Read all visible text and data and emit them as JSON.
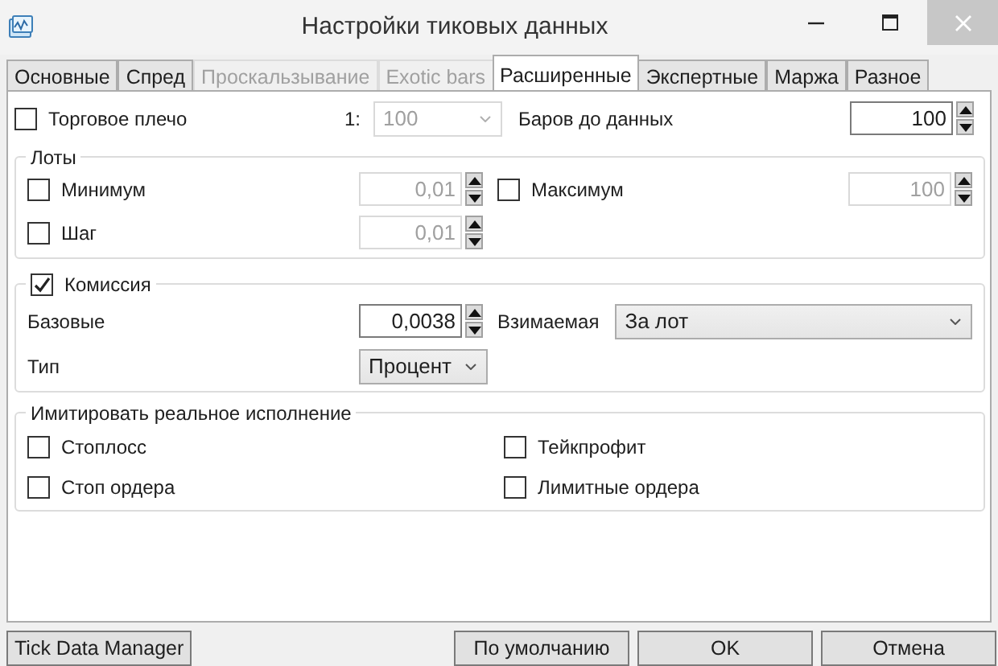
{
  "window": {
    "title": "Настройки тиковых данных"
  },
  "tabs": [
    {
      "label": "Основные",
      "selected": false,
      "disabled": false
    },
    {
      "label": "Спред",
      "selected": false,
      "disabled": false
    },
    {
      "label": "Проскальзывание",
      "selected": false,
      "disabled": true
    },
    {
      "label": "Exotic bars",
      "selected": false,
      "disabled": true
    },
    {
      "label": "Расширенные",
      "selected": true,
      "disabled": false
    },
    {
      "label": "Экспертные",
      "selected": false,
      "disabled": false
    },
    {
      "label": "Маржа",
      "selected": false,
      "disabled": false
    },
    {
      "label": "Разное",
      "selected": false,
      "disabled": false
    }
  ],
  "leverage": {
    "label": "Торговое плечо",
    "checked": false,
    "prefix": "1:",
    "value": "100",
    "disabled": true
  },
  "bars_before_data": {
    "label": "Баров до данных",
    "value": "100"
  },
  "lots": {
    "title": "Лоты",
    "minimum": {
      "label": "Минимум",
      "checked": false,
      "value": "0,01"
    },
    "maximum": {
      "label": "Максимум",
      "checked": false,
      "value": "100"
    },
    "step": {
      "label": "Шаг",
      "checked": false,
      "value": "0,01"
    }
  },
  "commission": {
    "label": "Комиссия",
    "checked": true,
    "base_label": "Базовые",
    "base_value": "0,0038",
    "charged_label": "Взимаемая",
    "charged_value": "За лот",
    "type_label": "Тип",
    "type_value": "Процент"
  },
  "simulate": {
    "title": "Имитировать реальное исполнение",
    "options": [
      {
        "label": "Стоплосс",
        "checked": false
      },
      {
        "label": "Тейкпрофит",
        "checked": false
      },
      {
        "label": "Стоп ордера",
        "checked": false
      },
      {
        "label": "Лимитные ордера",
        "checked": false
      }
    ]
  },
  "buttons": [
    {
      "label": "Tick Data Manager"
    },
    {
      "label": "По умолчанию"
    },
    {
      "label": "OK"
    },
    {
      "label": "Отмена"
    }
  ]
}
